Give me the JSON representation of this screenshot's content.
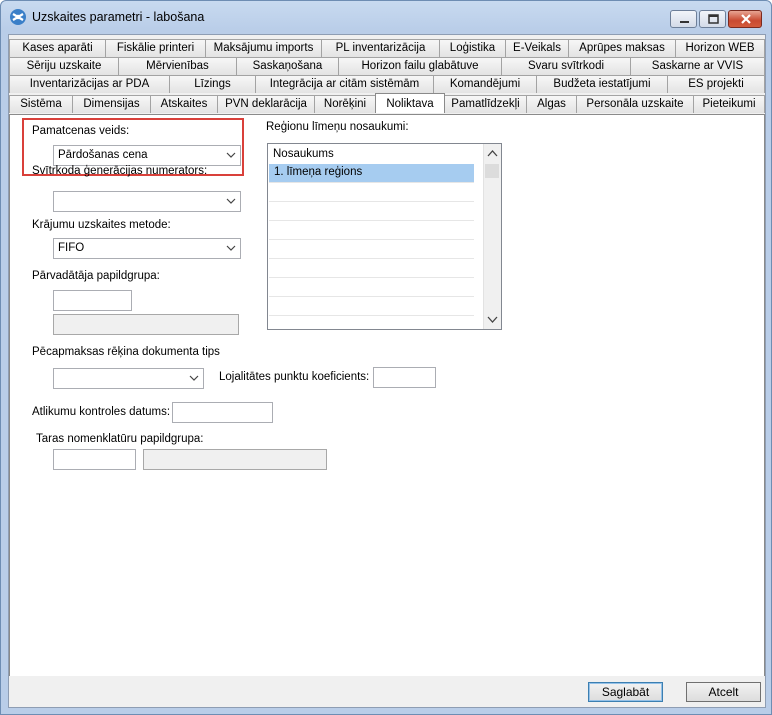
{
  "window": {
    "title": "Uzskaites parametri - labošana"
  },
  "tabs": {
    "row1": [
      "Kases aparāti",
      "Fiskālie printeri",
      "Maksājumu imports",
      "PL inventarizācija",
      "Loģistika",
      "E-Veikals",
      "Aprūpes maksas",
      "Horizon WEB"
    ],
    "row2": [
      "Sēriju uzskaite",
      "Mērvienības",
      "Saskaņošana",
      "Horizon failu glabātuve",
      "Svaru svītrkodi",
      "Saskarne ar VVIS"
    ],
    "row3": [
      "Inventarizācijas ar PDA",
      "Līzings",
      "Integrācija ar citām sistēmām",
      "Komandējumi",
      "Budžeta iestatījumi",
      "ES projekti"
    ],
    "row4": [
      "Sistēma",
      "Dimensijas",
      "Atskaites",
      "PVN deklarācija",
      "Norēķini",
      "Noliktava",
      "Pamatlīdzekļi",
      "Algas",
      "Personāla uzskaite",
      "Pieteikumi"
    ],
    "active": "Noliktava"
  },
  "form": {
    "base_price_type": {
      "label": "Pamatcenas veids:",
      "value": "Pārdošanas cena"
    },
    "barcode_generator": {
      "label": "Svītrkoda ģenerācijas numerators:",
      "value": ""
    },
    "inventory_method": {
      "label": "Krājumu uzskaites metode:",
      "value": "FIFO"
    },
    "seller_subgroup": {
      "label": "Pārvadātāja papildgrupa:",
      "code": "",
      "name": ""
    },
    "postpay_doc_type": {
      "label": "Pēcapmaksas rēķina dokumenta tips",
      "value": ""
    },
    "loyalty_coef": {
      "label": "Lojalitātes punktu koeficients:",
      "value": ""
    },
    "discount_date": {
      "label": "Atlikumu kontroles datums:",
      "value": ""
    },
    "tare_subgroup": {
      "label": "Taras nomenklatūru papildgrupa:",
      "code": "",
      "name": ""
    }
  },
  "regions": {
    "label": "Reģionu līmeņu nosaukumi:",
    "column": "Nosaukums",
    "rows": [
      "1. līmeņa reģions"
    ]
  },
  "buttons": {
    "save": "Saglabāt",
    "cancel": "Atcelt"
  },
  "colors": {
    "highlight": "#d9403a",
    "selection": "#a6ccf0"
  }
}
